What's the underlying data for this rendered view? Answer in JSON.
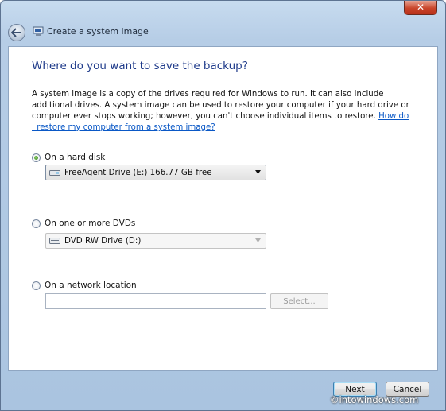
{
  "window": {
    "title": "Create a system image",
    "close_glyph": "✕"
  },
  "page": {
    "heading": "Where do you want to save the backup?",
    "description": "A system image is a copy of the drives required for Windows to run. It can also include additional drives. A system image can be used to restore your computer if your hard drive or computer ever stops working; however, you can't choose individual items to restore.",
    "help_link": "How do I restore my computer from a system image?"
  },
  "options": {
    "hard_disk": {
      "label_pre": "On a ",
      "label_key": "h",
      "label_post": "ard disk",
      "selected": true,
      "drive": "FreeAgent Drive (E:)  166.77 GB free",
      "icon": "hard-drive-icon"
    },
    "dvd": {
      "label_pre": "On one or more ",
      "label_key": "D",
      "label_post": "VDs",
      "selected": false,
      "drive": "DVD RW Drive (D:)",
      "icon": "dvd-drive-icon"
    },
    "network": {
      "label_pre": "On a ne",
      "label_key": "t",
      "label_post": "work location",
      "selected": false,
      "path_value": "",
      "select_button": "Select..."
    }
  },
  "footer": {
    "next_label": "Next",
    "cancel_label": "Cancel",
    "watermark": "©intowindows.com"
  },
  "colors": {
    "heading": "#1e3a8a",
    "link": "#0a58c6",
    "titlebar": "#b6cde6",
    "close": "#c9452b"
  }
}
